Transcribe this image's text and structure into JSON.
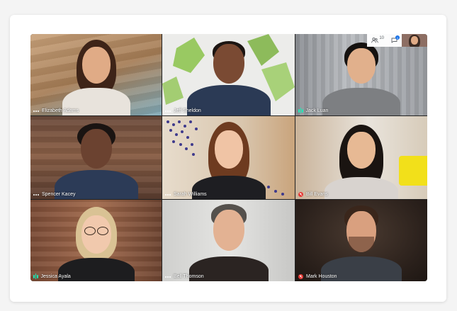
{
  "participants": [
    {
      "name": "Elizabeth Adams",
      "indicator": "dots"
    },
    {
      "name": "Jeff Sheldon",
      "indicator": "dots"
    },
    {
      "name": "Jack Luan",
      "indicator": "bars"
    },
    {
      "name": "Spencer Kacey",
      "indicator": "dots"
    },
    {
      "name": "Sarah Williams",
      "indicator": "dots"
    },
    {
      "name": "Bill Evans",
      "indicator": "muted"
    },
    {
      "name": "Jessica Ayala",
      "indicator": "bars"
    },
    {
      "name": "Bell Thomson",
      "indicator": "dots"
    },
    {
      "name": "Mark Houston",
      "indicator": "muted"
    }
  ],
  "toolbar": {
    "people_icon": "people-icon",
    "people_count": "10",
    "chat_icon": "chat-icon",
    "chat_badge": "1"
  },
  "colors": {
    "speaking": "#1de9b6",
    "muted": "#e53935",
    "badge": "#1a73e8"
  }
}
